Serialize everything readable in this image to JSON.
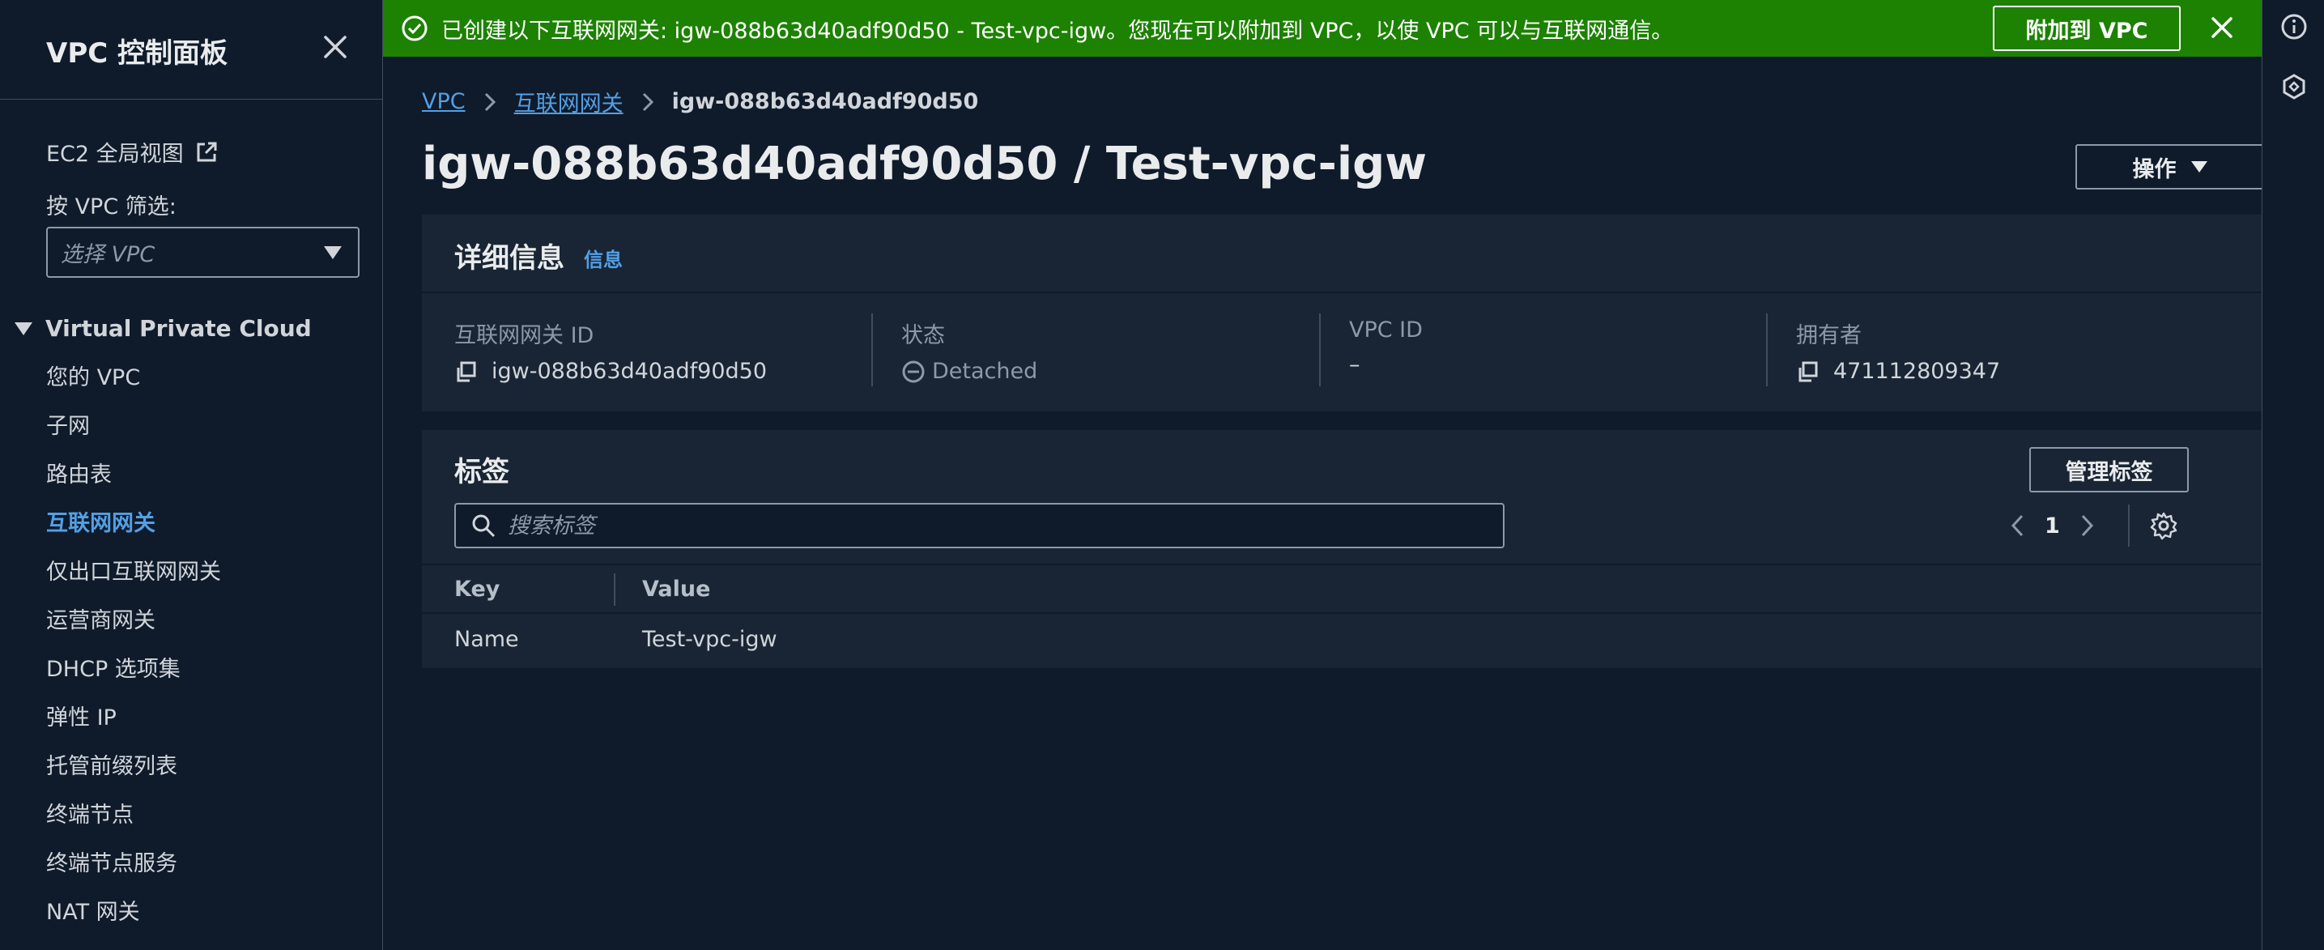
{
  "sidebar": {
    "title": "VPC 控制面板",
    "ec2_global_view": "EC2 全局视图",
    "filter_label": "按 VPC 筛选:",
    "filter_placeholder": "选择 VPC",
    "section_title": "Virtual Private Cloud",
    "items": [
      {
        "label": "您的 VPC"
      },
      {
        "label": "子网"
      },
      {
        "label": "路由表"
      },
      {
        "label": "互联网网关",
        "active": true
      },
      {
        "label": "仅出口互联网网关"
      },
      {
        "label": "运营商网关"
      },
      {
        "label": "DHCP 选项集"
      },
      {
        "label": "弹性 IP"
      },
      {
        "label": "托管前缀列表"
      },
      {
        "label": "终端节点"
      },
      {
        "label": "终端节点服务"
      },
      {
        "label": "NAT 网关"
      }
    ]
  },
  "flash": {
    "message": "已创建以下互联网网关: igw-088b63d40adf90d50 - Test-vpc-igw。您现在可以附加到 VPC，以使 VPC 可以与互联网通信。",
    "attach_label": "附加到 VPC"
  },
  "breadcrumb": {
    "root": "VPC",
    "parent": "互联网网关",
    "current": "igw-088b63d40adf90d50"
  },
  "page": {
    "title": "igw-088b63d40adf90d50 / Test-vpc-igw",
    "actions_label": "操作"
  },
  "details": {
    "title": "详细信息",
    "info_link": "信息",
    "fields": [
      {
        "key": "互联网网关 ID",
        "value": "igw-088b63d40adf90d50"
      },
      {
        "key": "状态",
        "value": "Detached"
      },
      {
        "key": "VPC ID",
        "value": "–"
      },
      {
        "key": "拥有者",
        "value": "471112809347"
      }
    ]
  },
  "tags": {
    "title": "标签",
    "manage_label": "管理标签",
    "search_placeholder": "搜索标签",
    "page_number": "1",
    "columns": [
      "Key",
      "Value"
    ],
    "rows": [
      {
        "key": "Name",
        "value": "Test-vpc-igw"
      }
    ]
  },
  "colors": {
    "background": "#0f1b2a",
    "panel": "#192534",
    "link": "#539fe5",
    "success": "#1d8102"
  }
}
